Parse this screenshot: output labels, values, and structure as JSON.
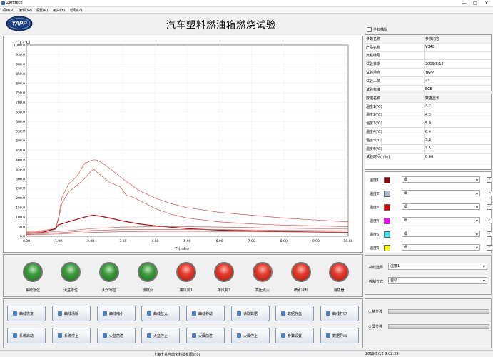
{
  "window": {
    "title": "Zergtech",
    "min": "—",
    "max": "□",
    "close": "✕"
  },
  "menu": [
    "项目(V)",
    "编辑(W)",
    "设置(R)",
    "用户(Y)",
    "帮助(Z)"
  ],
  "logo_text": "YAPP",
  "main_title": "汽车塑料燃油箱燃烧试验",
  "coord_capture": {
    "label": "坐标捕捉",
    "checked": false
  },
  "info_table": {
    "headers": [
      "参数名称",
      "参数内容"
    ],
    "rows": [
      [
        "产品名称",
        "V348"
      ],
      [
        "流程编号",
        ""
      ],
      [
        "试验日期",
        "2019/8/12"
      ],
      [
        "试验地点",
        "YAPP"
      ],
      [
        "试验人员",
        "ZL"
      ],
      [
        "试验标准",
        "ECE"
      ]
    ]
  },
  "data_table": {
    "headers": [
      "数据名称",
      "数据显示"
    ],
    "rows": [
      [
        "温度1(℃)",
        "4.7"
      ],
      [
        "温度2(℃)",
        "4.3"
      ],
      [
        "温度3(℃)",
        "5.0"
      ],
      [
        "温度4(℃)",
        "6.4"
      ],
      [
        "温度5(℃)",
        "3.8"
      ],
      [
        "温度6(℃)",
        "3.5"
      ],
      [
        "试验时间(min)",
        "0.00"
      ]
    ]
  },
  "sensors": [
    {
      "label": "温度1",
      "color": "#8b0000",
      "line": "细",
      "checked": true
    },
    {
      "label": "温度2",
      "color": "#a8b8d0",
      "line": "细",
      "checked": true
    },
    {
      "label": "温度3",
      "color": "#e00000",
      "line": "细",
      "checked": true
    },
    {
      "label": "温度4",
      "color": "#ff00ff",
      "line": "细",
      "checked": true
    },
    {
      "label": "温度5",
      "color": "#33e0f0",
      "line": "细",
      "checked": true
    },
    {
      "label": "温度6",
      "color": "#ffff00",
      "line": "细",
      "checked": true
    }
  ],
  "lamps": [
    {
      "label": "系统零位",
      "state": "green"
    },
    {
      "label": "火盆零位",
      "state": "green"
    },
    {
      "label": "火屏零位",
      "state": "green"
    },
    {
      "label": "预燃火",
      "state": "green"
    },
    {
      "label": "排风机1",
      "state": "red"
    },
    {
      "label": "排风机2",
      "state": "red"
    },
    {
      "label": "高压点火",
      "state": "red"
    },
    {
      "label": "喷水冷却",
      "state": "red"
    },
    {
      "label": "消防器",
      "state": "red"
    }
  ],
  "curve_select": {
    "label": "曲线选择",
    "value": "温度1"
  },
  "control_mode": {
    "label": "控制方式",
    "value": "自动"
  },
  "buttons_row1": [
    "曲线恢复",
    "曲线清除",
    "曲线缩小",
    "曲线放大",
    "曲线移动",
    "读取数据",
    "数据存盘",
    "曲线打印"
  ],
  "buttons_row2": [
    "系统启动",
    "系统停止",
    "火盆前进",
    "火盆停止",
    "火屏前进",
    "火屏停止",
    "参数设置",
    "数据导出"
  ],
  "positions": [
    {
      "label": "火盆位移"
    },
    {
      "label": "火屏位移"
    }
  ],
  "status": {
    "company": "上海士意自动化科技有限公司",
    "datetime": "2019/8/12 9:02:39"
  },
  "chart_data": {
    "type": "line",
    "title": "",
    "xlabel": "T (min)",
    "ylabel": "T (℃)",
    "xlim": [
      0,
      10
    ],
    "ylim": [
      0,
      1000
    ],
    "xticks": [
      "0.00",
      "1.00",
      "2.00",
      "3.00",
      "4.00",
      "5.00",
      "6.00",
      "7.00",
      "8.00",
      "9.00",
      "10.00"
    ],
    "yticks": [
      "0.0",
      "50.0",
      "100.0",
      "150.0",
      "200.0",
      "250.0",
      "300.0",
      "350.0",
      "400.0",
      "450.0",
      "500.0",
      "550.0",
      "600.0",
      "650.0",
      "700.0",
      "750.0",
      "800.0",
      "850.0",
      "900.0",
      "950.0",
      "1000.0"
    ],
    "grid": true,
    "series": [
      {
        "color": "#cc5555",
        "width": 0.7,
        "x": [
          0,
          0.5,
          0.9,
          1.0,
          1.1,
          1.3,
          1.6,
          1.8,
          2.0,
          2.1,
          2.2,
          2.4,
          2.7,
          3.0,
          3.5,
          4.0,
          4.5,
          5.0,
          6.0,
          7.0,
          8.0,
          9.0,
          10.0
        ],
        "y": [
          25,
          30,
          40,
          100,
          200,
          270,
          320,
          380,
          395,
          400,
          398,
          380,
          340,
          300,
          240,
          200,
          170,
          150,
          125,
          110,
          95,
          85,
          75
        ]
      },
      {
        "color": "#cc5555",
        "width": 0.7,
        "x": [
          0,
          0.5,
          0.9,
          1.0,
          1.1,
          1.3,
          1.6,
          1.8,
          2.0,
          2.1,
          2.3,
          2.6,
          2.9,
          3.0,
          3.1,
          3.3,
          3.6,
          4.0,
          4.5,
          5.0,
          6.0,
          7.0,
          8.0,
          9.0,
          10.0
        ],
        "y": [
          20,
          25,
          35,
          90,
          170,
          230,
          270,
          300,
          340,
          350,
          320,
          280,
          260,
          240,
          215,
          205,
          180,
          145,
          115,
          95,
          75,
          65,
          58,
          55,
          50
        ]
      },
      {
        "color": "#a01010",
        "width": 1.2,
        "x": [
          0,
          0.5,
          0.9,
          1.0,
          1.2,
          1.5,
          1.8,
          2.0,
          2.1,
          2.3,
          2.6,
          3.0,
          3.5,
          4.0,
          5.0,
          6.0,
          7.0,
          8.0,
          9.0,
          10.0
        ],
        "y": [
          15,
          20,
          40,
          60,
          70,
          85,
          100,
          108,
          110,
          105,
          95,
          80,
          65,
          55,
          40,
          32,
          28,
          25,
          22,
          20
        ]
      },
      {
        "color": "#c86060",
        "width": 0.7,
        "x": [
          0,
          1.0,
          2.0,
          3.0,
          4.0,
          5.0,
          6.0,
          7.0,
          8.0,
          9.0,
          10.0
        ],
        "y": [
          15,
          25,
          40,
          48,
          50,
          50,
          48,
          45,
          42,
          40,
          38
        ]
      },
      {
        "color": "#c86060",
        "width": 0.7,
        "x": [
          0,
          1.0,
          2.0,
          3.0,
          4.0,
          5.0,
          6.0,
          7.0,
          8.0,
          9.0,
          10.0
        ],
        "y": [
          10,
          18,
          30,
          35,
          36,
          36,
          35,
          33,
          31,
          30,
          29
        ]
      },
      {
        "color": "#c86060",
        "width": 0.7,
        "x": [
          0,
          1.0,
          2.0,
          3.0,
          4.0,
          5.0,
          6.0,
          7.0,
          8.0,
          9.0,
          10.0
        ],
        "y": [
          8,
          12,
          20,
          24,
          26,
          26,
          25,
          24,
          23,
          22,
          21
        ]
      }
    ]
  }
}
